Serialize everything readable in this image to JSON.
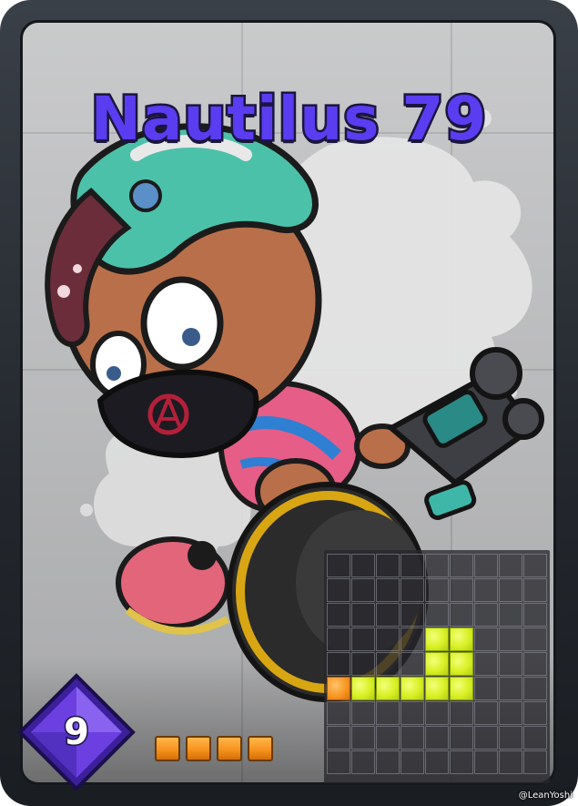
{
  "card": {
    "name": "Nautilus 79",
    "cost": "9",
    "special_cost": 4,
    "credit": "@LeanYoshi"
  },
  "colors": {
    "title_fill": "#5a3df0",
    "title_outline": "#1a1640",
    "ink": "#d8f024",
    "special": "#f7931e",
    "gem": "#6b3fe0",
    "frame": "#2a2e34"
  },
  "icons": {
    "cost_badge": "purple-diamond-gem",
    "special_point": "orange-square"
  },
  "ink_pattern": {
    "grid_columns": 9,
    "grid_rows": 9,
    "ink_cells": [
      [
        4,
        3
      ],
      [
        5,
        3
      ],
      [
        4,
        4
      ],
      [
        5,
        4
      ],
      [
        1,
        5
      ],
      [
        2,
        5
      ],
      [
        3,
        5
      ],
      [
        4,
        5
      ],
      [
        5,
        5
      ]
    ],
    "special_cell": [
      0,
      5
    ]
  }
}
